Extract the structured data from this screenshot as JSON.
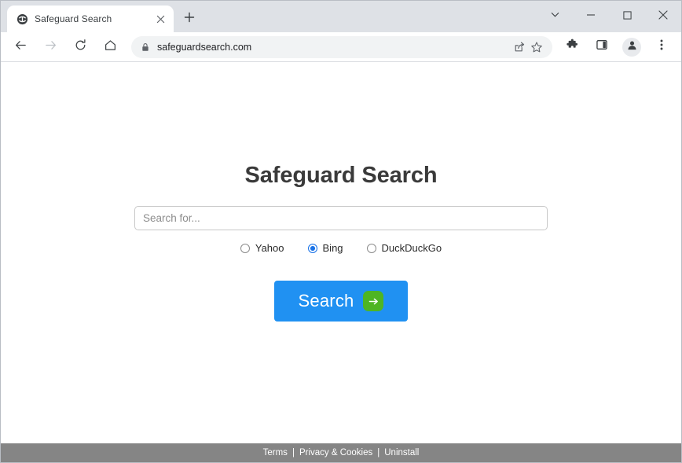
{
  "browser": {
    "tab": {
      "title": "Safeguard Search",
      "favicon_icon": "globe-swirl-icon",
      "close_icon": "close-icon"
    },
    "new_tab_icon": "plus-icon",
    "window_controls": {
      "chevron_icon": "chevron-down-icon",
      "minimize_icon": "minimize-icon",
      "maximize_icon": "maximize-icon",
      "close_icon": "close-icon"
    },
    "toolbar": {
      "back_icon": "back-arrow-icon",
      "forward_icon": "forward-arrow-icon",
      "reload_icon": "reload-icon",
      "home_icon": "home-icon",
      "lock_icon": "lock-icon",
      "url": "safeguardsearch.com",
      "share_icon": "share-icon",
      "bookmark_icon": "star-icon",
      "extensions_icon": "puzzle-icon",
      "side_panel_icon": "side-panel-icon",
      "profile_icon": "avatar-person-icon",
      "menu_icon": "three-dots-menu-icon"
    }
  },
  "page": {
    "title": "Safeguard Search",
    "search": {
      "placeholder": "Search for...",
      "value": ""
    },
    "engines": [
      {
        "label": "Yahoo",
        "selected": false
      },
      {
        "label": "Bing",
        "selected": true
      },
      {
        "label": "DuckDuckGo",
        "selected": false
      }
    ],
    "search_button": {
      "label": "Search",
      "arrow_icon": "right-arrow-icon"
    },
    "footer": {
      "terms": "Terms",
      "privacy": "Privacy & Cookies",
      "uninstall": "Uninstall",
      "separator": "|"
    }
  },
  "colors": {
    "accent_blue": "#2091f2",
    "go_green": "#4eb523",
    "radio_blue": "#1a73e8",
    "footer_gray": "#858585",
    "title_gray": "#3a3a3a"
  }
}
